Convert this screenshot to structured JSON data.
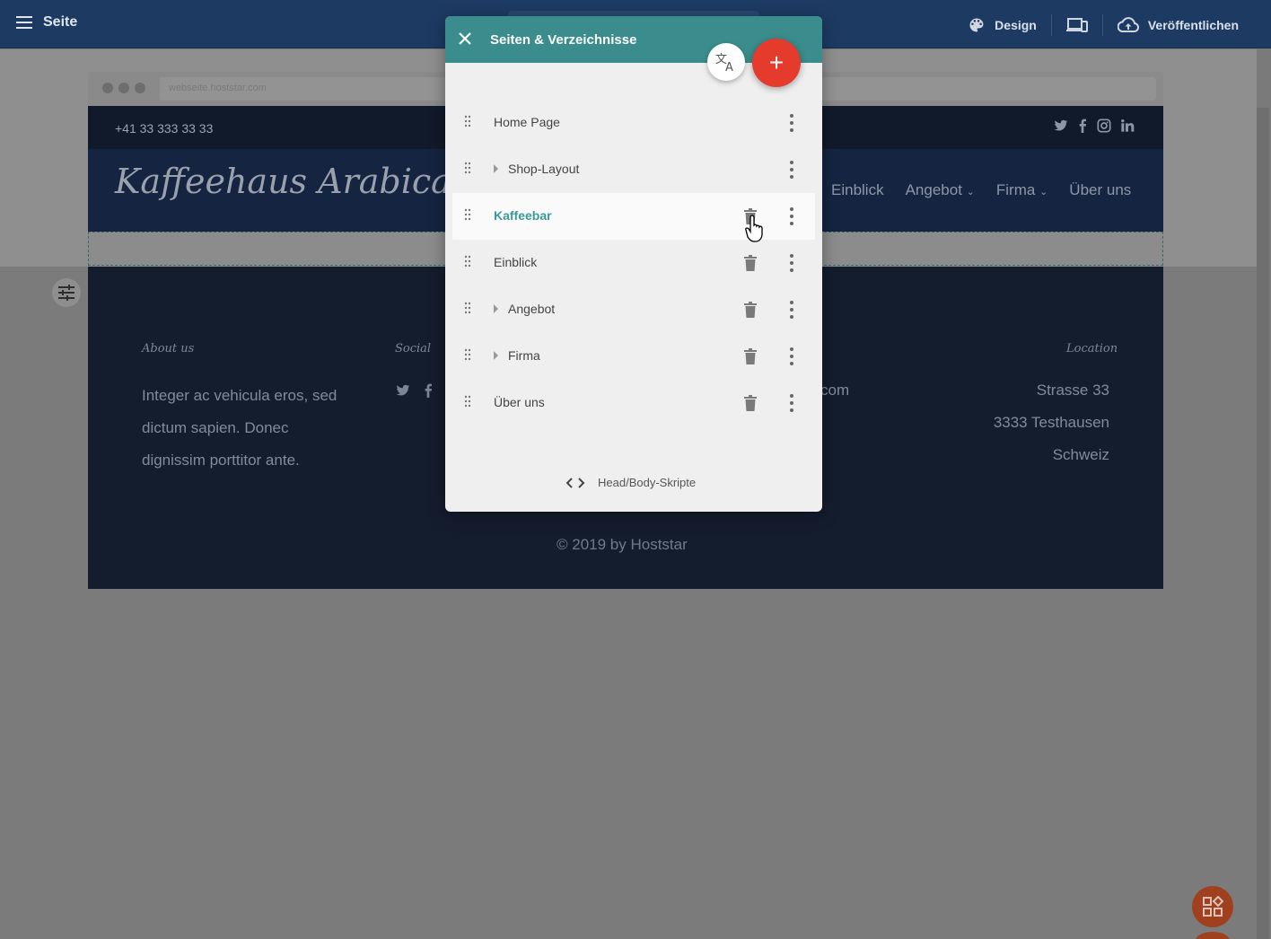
{
  "topbar": {
    "page_label": "Seite",
    "design_label": "Design",
    "publish_label": "Veröffentlichen"
  },
  "site": {
    "url": "webseite.hoststar.com",
    "phone": "+41 33 333 33 33",
    "logo": "Kaffeehaus Arabica",
    "nav": [
      "Einblick",
      "Angebot",
      "Firma",
      "Über uns"
    ],
    "footer": {
      "about_heading": "About us",
      "about_text": [
        "Integer ac vehicula eros, sed",
        "dictum sapien. Donec",
        "dignissim porttitor ante."
      ],
      "social_heading": "Social",
      "email_fragment": "com",
      "location_heading": "Location",
      "location_lines": [
        "Strasse 33",
        "3333 Testhausen",
        "Schweiz"
      ],
      "copyright": "© 2019 by Hoststar"
    }
  },
  "dialog": {
    "title": "Seiten & Verzeichnisse",
    "pages": [
      {
        "label": "Home Page",
        "has_children": false,
        "active": false,
        "deletable": false
      },
      {
        "label": "Shop-Layout",
        "has_children": true,
        "active": false,
        "deletable": false
      },
      {
        "label": "Kaffeebar",
        "has_children": false,
        "active": true,
        "deletable": true
      },
      {
        "label": "Einblick",
        "has_children": false,
        "active": false,
        "deletable": true
      },
      {
        "label": "Angebot",
        "has_children": true,
        "active": false,
        "deletable": true
      },
      {
        "label": "Firma",
        "has_children": true,
        "active": false,
        "deletable": true
      },
      {
        "label": "Über uns",
        "has_children": false,
        "active": false,
        "deletable": true
      }
    ],
    "scripts_label": "Head/Body-Skripte"
  },
  "colors": {
    "accent": "#3a8d8c",
    "add_button": "#e53b2c",
    "topbar": "#1d3a63"
  }
}
